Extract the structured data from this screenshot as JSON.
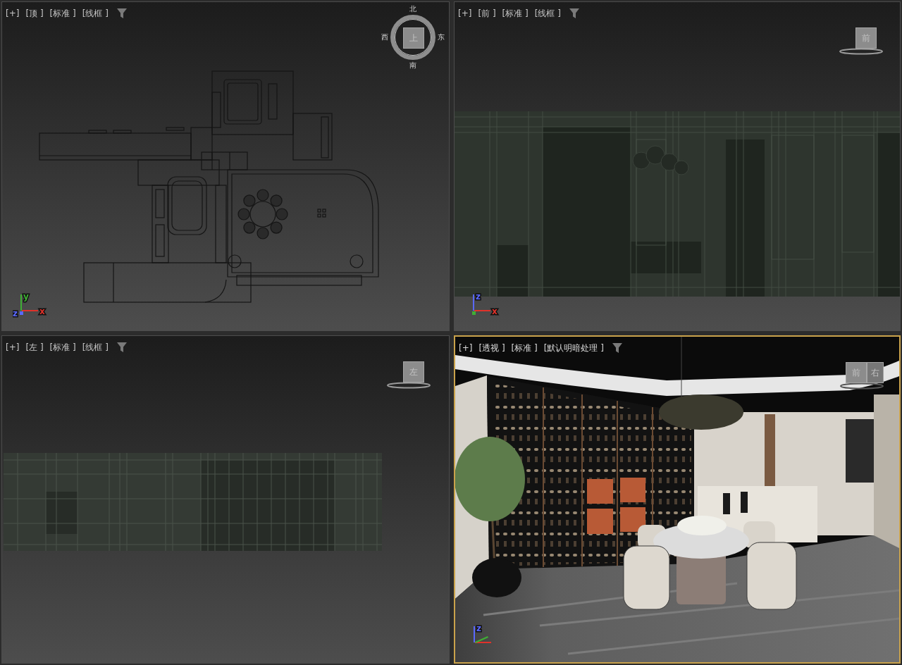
{
  "viewports": [
    {
      "kind": "top",
      "selected": false,
      "labels": [
        "[+]",
        "[顶 ]",
        "[标准 ]",
        "[线框 ]"
      ],
      "viewcube": {
        "faces": [
          "上"
        ],
        "compass": [
          "北",
          "东",
          "南",
          "西"
        ]
      },
      "axes": [
        {
          "kind": "up",
          "label": "y",
          "color": "#3fae35"
        },
        {
          "kind": "origin",
          "label": "z",
          "color": "#5a68ff"
        },
        {
          "kind": "right",
          "label": "x",
          "color": "#e0322a"
        }
      ]
    },
    {
      "kind": "front",
      "selected": false,
      "labels": [
        "[+]",
        "[前 ]",
        "[标准 ]",
        "[线框 ]"
      ],
      "viewcube": {
        "faces": [
          "前"
        ]
      },
      "axes": [
        {
          "kind": "up",
          "label": "z",
          "color": "#5a68ff"
        },
        {
          "kind": "origin",
          "color": "#3fae35"
        },
        {
          "kind": "right",
          "label": "x",
          "color": "#e0322a"
        }
      ]
    },
    {
      "kind": "left",
      "selected": false,
      "labels": [
        "[+]",
        "[左 ]",
        "[标准 ]",
        "[线框 ]"
      ],
      "viewcube": {
        "faces": [
          "左"
        ]
      }
    },
    {
      "kind": "perspective",
      "selected": true,
      "labels": [
        "[+]",
        "[透视 ]",
        "[标准 ]",
        "[默认明暗处理 ]"
      ],
      "viewcube": {
        "faces": [
          "前",
          "右"
        ]
      },
      "axes": [
        {
          "kind": "up",
          "label": "z",
          "color": "#5a68ff"
        },
        {
          "kind": "right",
          "color": "#e0322a"
        },
        {
          "kind": "depth",
          "color": "#3fae35"
        }
      ]
    }
  ]
}
